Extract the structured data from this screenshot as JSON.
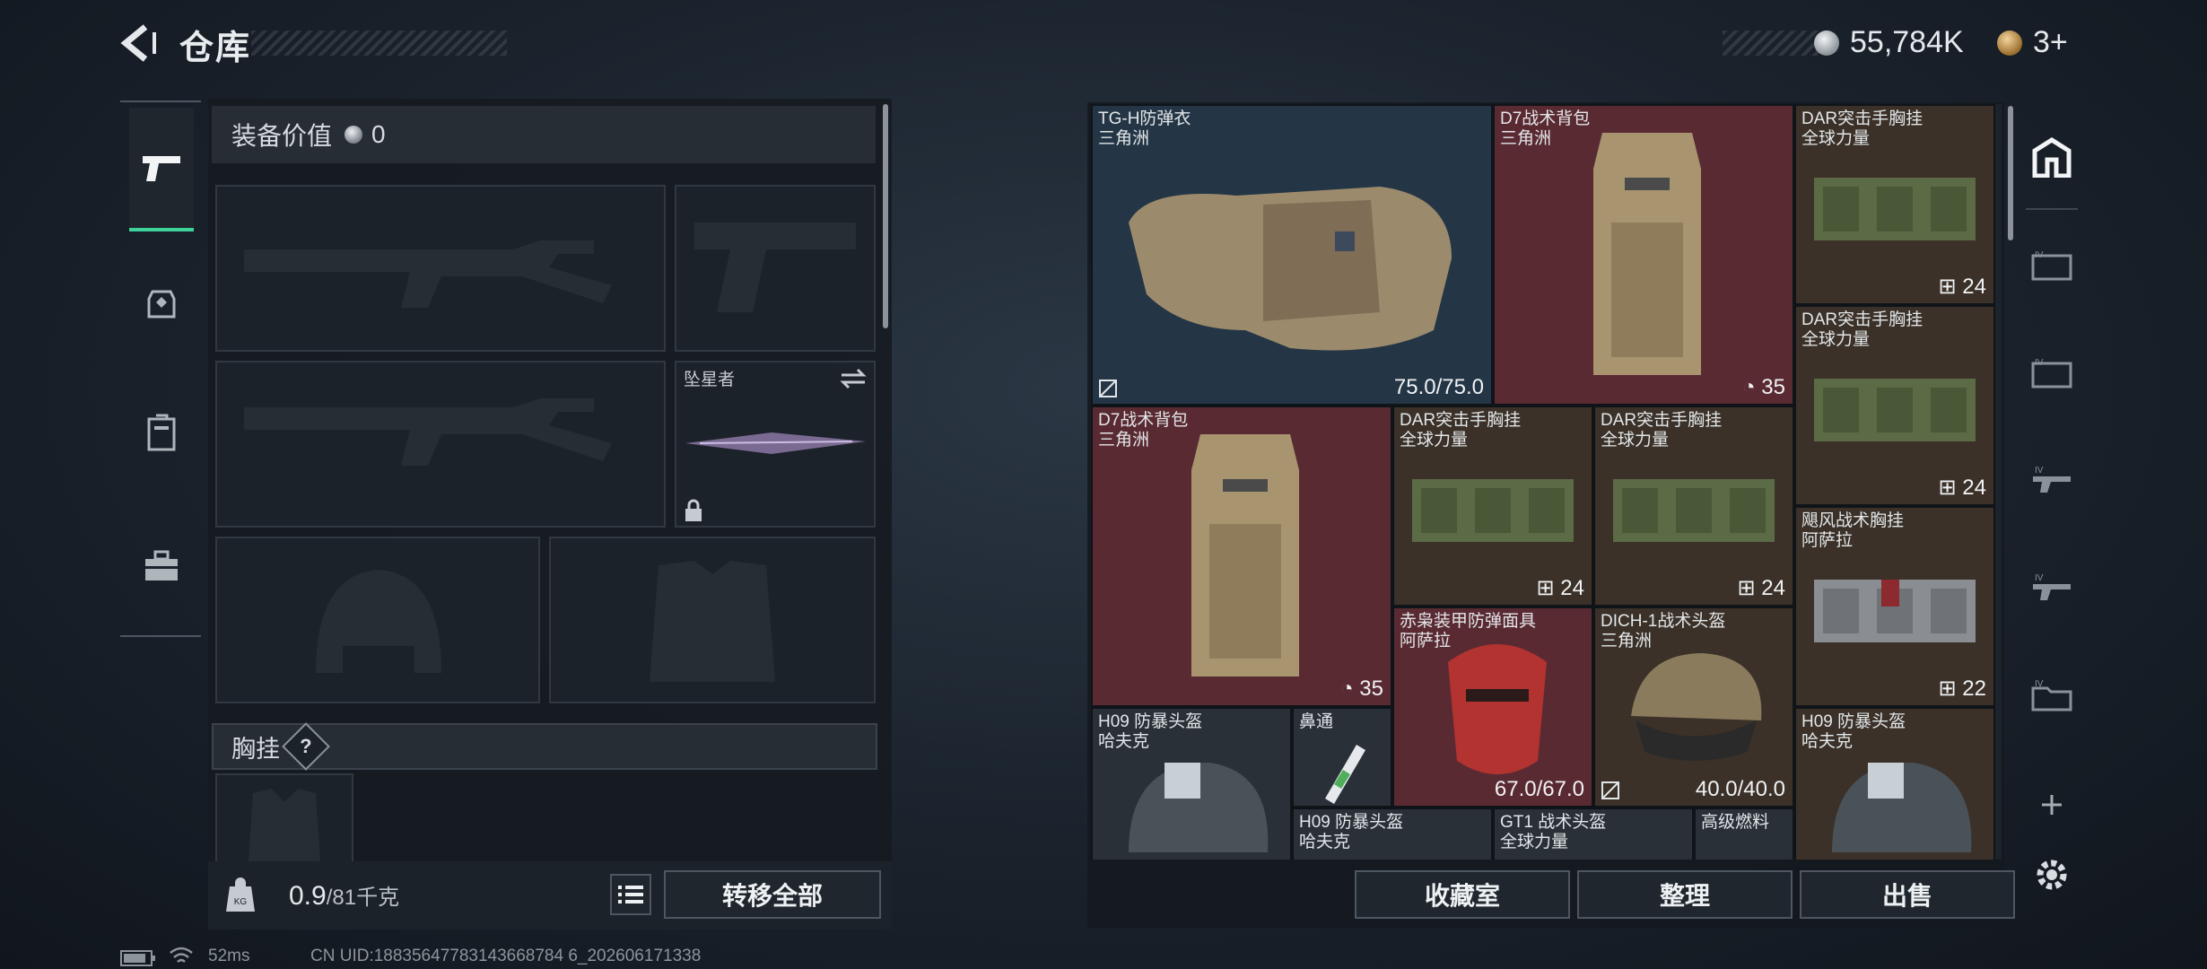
{
  "header": {
    "title": "仓库",
    "currency_silver": "55,784K",
    "currency_gold": "3+"
  },
  "left_tabs": [
    {
      "name": "weapons",
      "icon": "pistol-icon",
      "active": true
    },
    {
      "name": "armor",
      "icon": "backpack-icon",
      "active": false
    },
    {
      "name": "container",
      "icon": "locker-icon",
      "active": false
    },
    {
      "name": "toolbox",
      "icon": "toolbox-icon",
      "active": false
    }
  ],
  "loadout": {
    "value_label": "装备价值",
    "value": "0",
    "melee_slot_label": "坠星者",
    "chest_rig_label": "胸挂",
    "chest_rig_help": "?",
    "weight_current": "0.9",
    "weight_max": "/81千克",
    "transfer_all": "转移全部"
  },
  "stash": {
    "items": [
      {
        "name": "TG-H防弹衣",
        "sub": "三角洲",
        "stat": "75.0/75.0",
        "color": "blue"
      },
      {
        "name": "D7战术背包",
        "sub": "三角洲",
        "stat": "35",
        "color": "red"
      },
      {
        "name": "DAR突击手胸挂",
        "sub": "全球力量",
        "stat": "24",
        "color": "brown"
      },
      {
        "name": "DAR突击手胸挂",
        "sub": "全球力量",
        "stat": "24",
        "color": "brown"
      },
      {
        "name": "D7战术背包",
        "sub": "三角洲",
        "stat": "35",
        "color": "red"
      },
      {
        "name": "DAR突击手胸挂",
        "sub": "全球力量",
        "stat": "24",
        "color": "brown"
      },
      {
        "name": "DAR突击手胸挂",
        "sub": "全球力量",
        "stat": "24",
        "color": "brown"
      },
      {
        "name": "飓风战术胸挂",
        "sub": "阿萨拉",
        "stat": "22",
        "color": "brown"
      },
      {
        "name": "赤枭装甲防弹面具",
        "sub": "阿萨拉",
        "stat": "67.0/67.0",
        "color": "red"
      },
      {
        "name": "DICH-1战术头盔",
        "sub": "三角洲",
        "stat": "40.0/40.0",
        "color": "brown"
      },
      {
        "name": "H09 防暴头盔",
        "sub": "哈夫克",
        "stat": "",
        "color": "gray"
      },
      {
        "name": "鼻通",
        "sub": "",
        "stat": "",
        "color": "gray"
      },
      {
        "name": "H09 防暴头盔",
        "sub": "哈夫克",
        "stat": "",
        "color": "brown"
      },
      {
        "name": "H09 防暴头盔",
        "sub": "哈夫克",
        "stat": "",
        "color": "gray"
      },
      {
        "name": "GT1 战术头盔",
        "sub": "全球力量",
        "stat": "",
        "color": "gray"
      },
      {
        "name": "高级燃料",
        "sub": "",
        "stat": "",
        "color": "gray"
      }
    ],
    "buttons": {
      "vault": "收藏室",
      "sort": "整理",
      "sell": "出售"
    }
  },
  "right_tabs": [
    {
      "icon": "stash-icon"
    },
    {
      "icon": "case-tier4-icon"
    },
    {
      "icon": "case-tier4-icon"
    },
    {
      "icon": "weapon-case-icon"
    },
    {
      "icon": "weapon-case-icon"
    },
    {
      "icon": "folder-case-icon"
    }
  ],
  "footer": {
    "ping": "52ms",
    "uid": "CN UID:18835647783143668784 6_202606171338"
  },
  "colors": {
    "accent_green": "#3cd29a",
    "blue_rarity": "#243645",
    "red_rarity": "#5a2a32",
    "brown_rarity": "#3b3128"
  }
}
